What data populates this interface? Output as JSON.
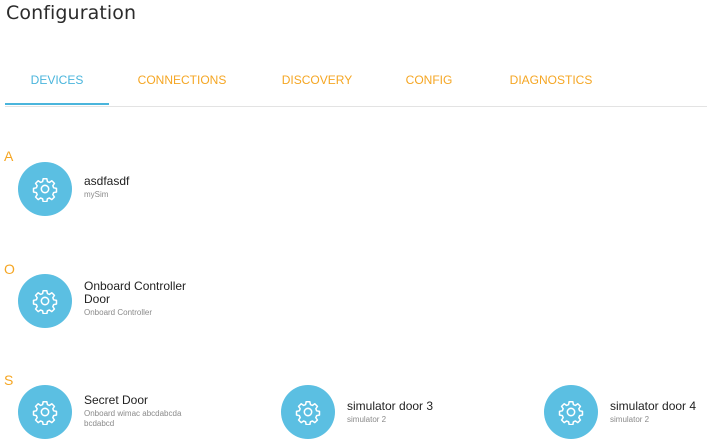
{
  "page": {
    "title": "Configuration"
  },
  "tabs": [
    {
      "label": "DEVICES",
      "active": true
    },
    {
      "label": "CONNECTIONS",
      "active": false
    },
    {
      "label": "DISCOVERY",
      "active": false
    },
    {
      "label": "CONFIG",
      "active": false
    },
    {
      "label": "DIAGNOSTICS",
      "active": false
    }
  ],
  "colors": {
    "accent_orange": "#f5a623",
    "accent_blue": "#4ab5dc",
    "avatar_blue": "#5bbfe2"
  },
  "groups": [
    {
      "letter": "A",
      "devices": [
        {
          "name": "asdfasdf",
          "subtitle": "mySim",
          "icon": "gear-icon"
        }
      ]
    },
    {
      "letter": "O",
      "devices": [
        {
          "name": "Onboard Controller Door",
          "subtitle": "Onboard Controller",
          "icon": "gear-icon"
        }
      ]
    },
    {
      "letter": "S",
      "devices": [
        {
          "name": "Secret Door",
          "subtitle": "Onboard wimac abcdabcdabcdabcd",
          "icon": "gear-icon"
        },
        {
          "name": "simulator door 3",
          "subtitle": "simulator 2",
          "icon": "gear-icon"
        },
        {
          "name": "simulator door 4",
          "subtitle": "simulator 2",
          "icon": "gear-icon"
        }
      ]
    }
  ]
}
